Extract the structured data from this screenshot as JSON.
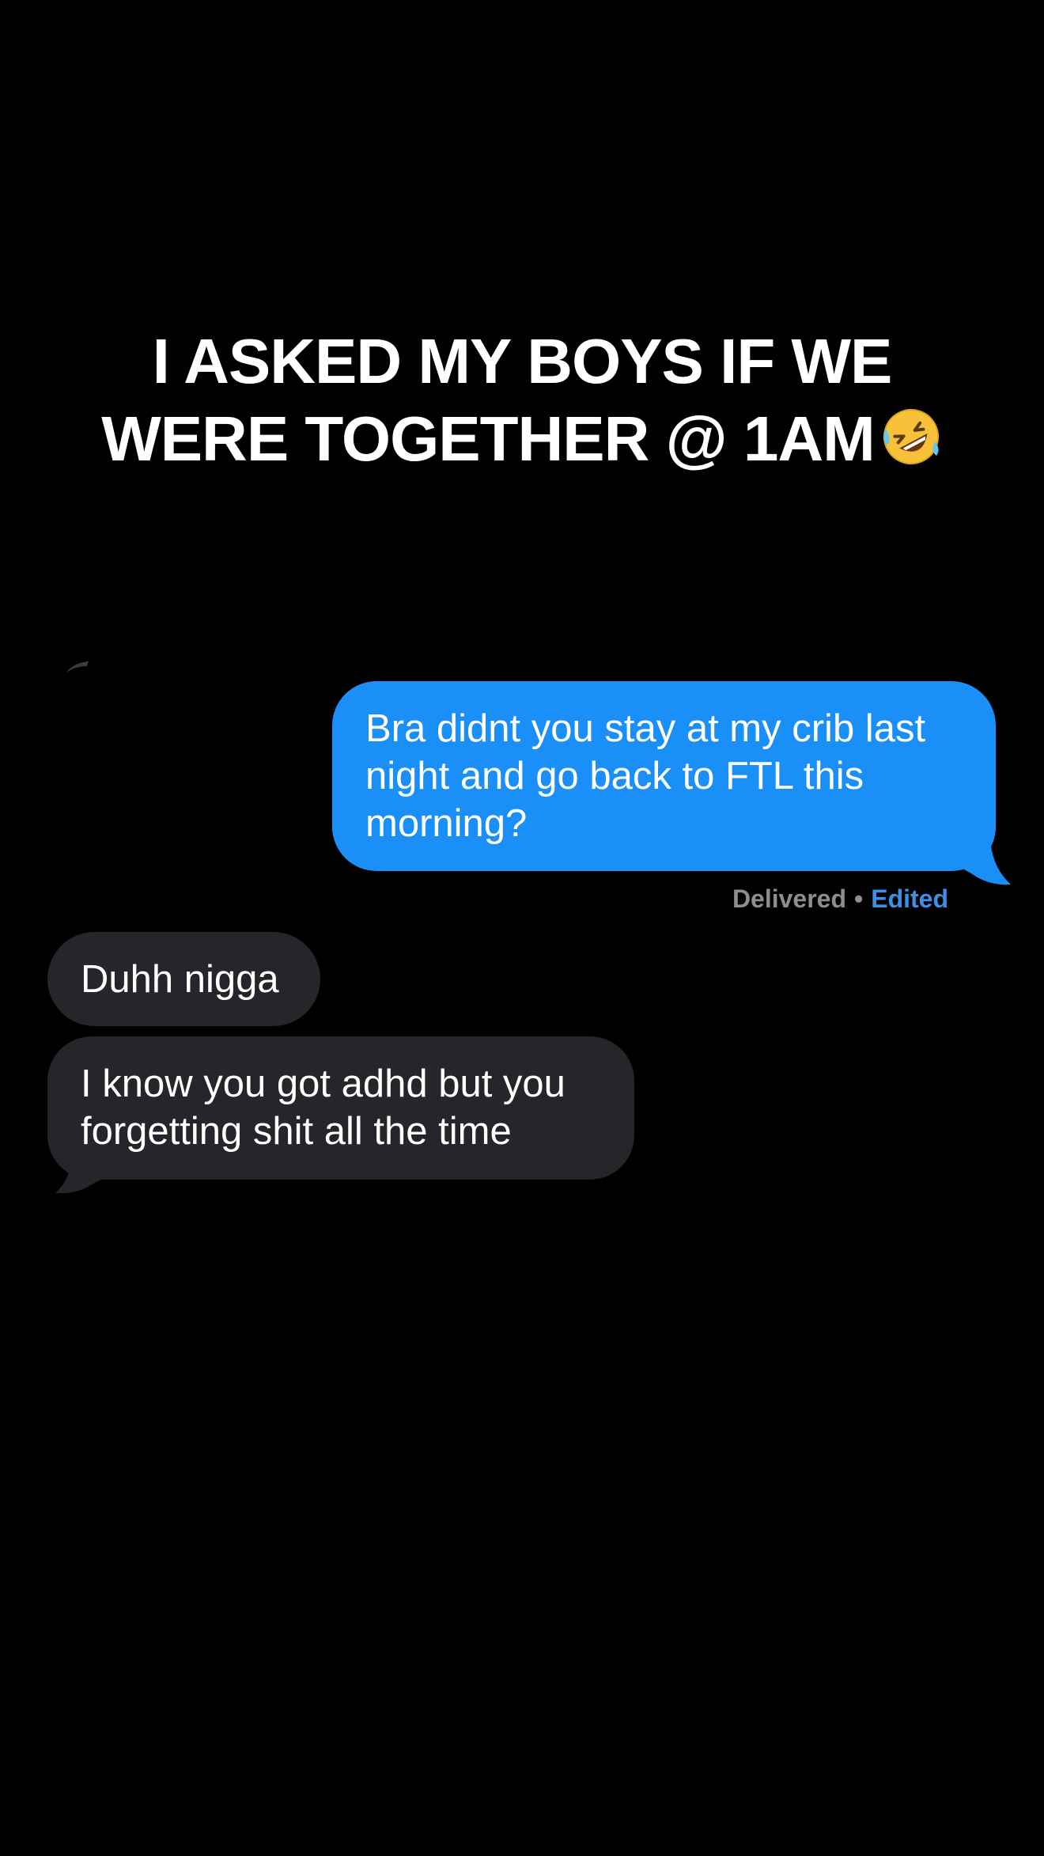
{
  "caption": {
    "line1": "I ASKED MY BOYS IF WE",
    "line2": "WERE TOGETHER @ 1AM",
    "emoji": "rolling-on-the-floor-laughing-emoji"
  },
  "messages": [
    {
      "direction": "sent",
      "lines": [
        "Bra didnt you stay at my crib last",
        "night and go back to FTL this",
        "morning?"
      ]
    },
    {
      "direction": "received",
      "lines": [
        "Duhh nigga"
      ]
    },
    {
      "direction": "received",
      "lines": [
        "I know you got adhd but you",
        "forgetting shit all the time"
      ]
    }
  ],
  "status": {
    "delivered": "Delivered",
    "separator": "•",
    "edited": "Edited"
  },
  "colors": {
    "background": "#000000",
    "sent_bubble": "#1a8ff8",
    "received_bubble": "#26252a",
    "status_gray": "#8d8d93",
    "edited_blue": "#3d8fe6"
  }
}
